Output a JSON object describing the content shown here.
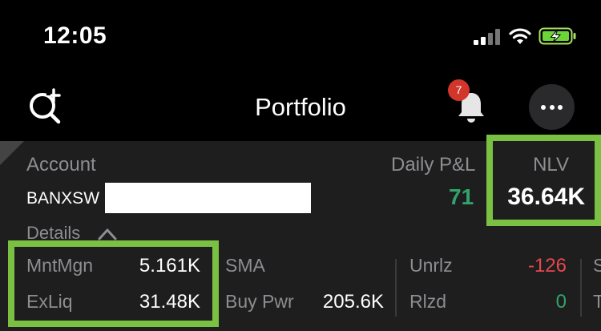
{
  "status_bar": {
    "time": "12:05"
  },
  "header": {
    "title": "Portfolio",
    "notification_count": "7"
  },
  "account": {
    "label": "Account",
    "id": "BANXSW",
    "details_label": "Details"
  },
  "summary": {
    "daily_pnl_label": "Daily P&L",
    "daily_pnl_value": "71",
    "nlv_label": "NLV",
    "nlv_value": "36.64K"
  },
  "metrics": {
    "mntmgn_label": "MntMgn",
    "mntmgn_value": "5.161K",
    "exliq_label": "ExLiq",
    "exliq_value": "31.48K",
    "sma_label": "SMA",
    "buypwr_label": "Buy Pwr",
    "buypwr_value": "205.6K",
    "unrlz_label": "Unrlz",
    "unrlz_value": "-126",
    "rlzd_label": "Rlzd",
    "rlzd_value": "0",
    "cut_col_1": "S",
    "cut_col_2": "T"
  },
  "colors": {
    "positive": "#30a46c",
    "negative": "#e5484d",
    "highlight": "#7ac143",
    "badge": "#d2362b"
  }
}
